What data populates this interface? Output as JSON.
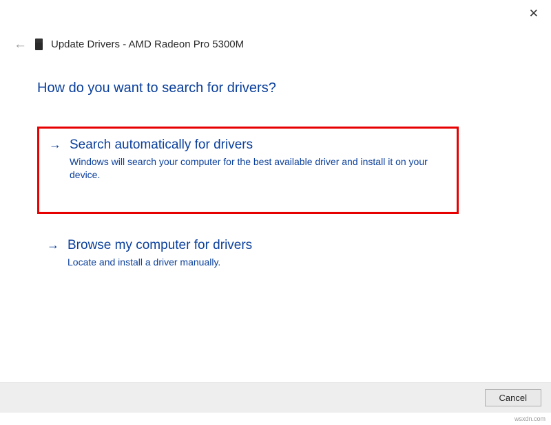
{
  "window": {
    "title": "Update Drivers - AMD Radeon Pro 5300M"
  },
  "heading": "How do you want to search for drivers?",
  "options": {
    "auto": {
      "title": "Search automatically for drivers",
      "desc": "Windows will search your computer for the best available driver and install it on your device."
    },
    "browse": {
      "title": "Browse my computer for drivers",
      "desc": "Locate and install a driver manually."
    }
  },
  "buttons": {
    "cancel": "Cancel"
  },
  "watermark": "wsxdn.com"
}
